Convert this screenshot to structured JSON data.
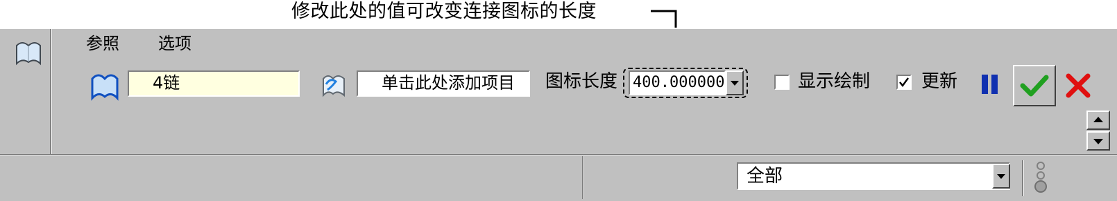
{
  "annotation": {
    "text": "修改此处的值可改变连接图标的长度"
  },
  "dashboard": {
    "tabs": [
      {
        "label": "参照"
      },
      {
        "label": "选项"
      }
    ],
    "chain_field": {
      "value": "4链"
    },
    "reference_field": {
      "value": "单击此处添加项目"
    },
    "icon_length": {
      "label": "图标长度",
      "value": "400.000000"
    },
    "show_draw": {
      "label": "显示绘制",
      "checked": false
    },
    "update": {
      "label": "更新",
      "checked": true
    },
    "status": {
      "filter_value": "全部"
    },
    "colors": {
      "panel": "#c0c0c0",
      "field_yellow": "#ffffe0",
      "pause_blue": "#1030b0",
      "ok_green": "#20a020",
      "cancel_red": "#e01010"
    },
    "icons": [
      "sketch-icon",
      "chain-icon",
      "reference-icon",
      "pause-icon",
      "confirm-icon",
      "cancel-icon",
      "scroll-up-icon",
      "scroll-down-icon",
      "dropdown-arrow-icon",
      "status-light-icon"
    ]
  }
}
